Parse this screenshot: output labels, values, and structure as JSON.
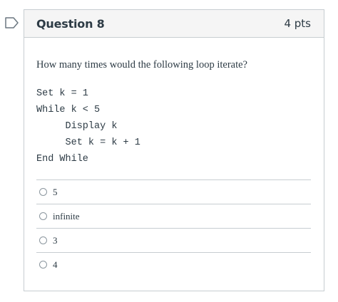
{
  "question": {
    "title": "Question 8",
    "points": "4 pts",
    "prompt": "How many times would the following loop iterate?",
    "code_lines": [
      "Set k = 1",
      "While k < 5",
      "     Display k",
      "     Set k = k + 1",
      "End While"
    ],
    "answers": [
      {
        "label": "5",
        "selected": false
      },
      {
        "label": "infinite",
        "selected": false
      },
      {
        "label": "3",
        "selected": false
      },
      {
        "label": "4",
        "selected": false
      }
    ]
  },
  "icons": {
    "flag": "flag-icon",
    "radio": "radio-button"
  },
  "colors": {
    "header_bg": "#f5f5f5",
    "border": "#c7cdd1",
    "text": "#2d3b45"
  }
}
